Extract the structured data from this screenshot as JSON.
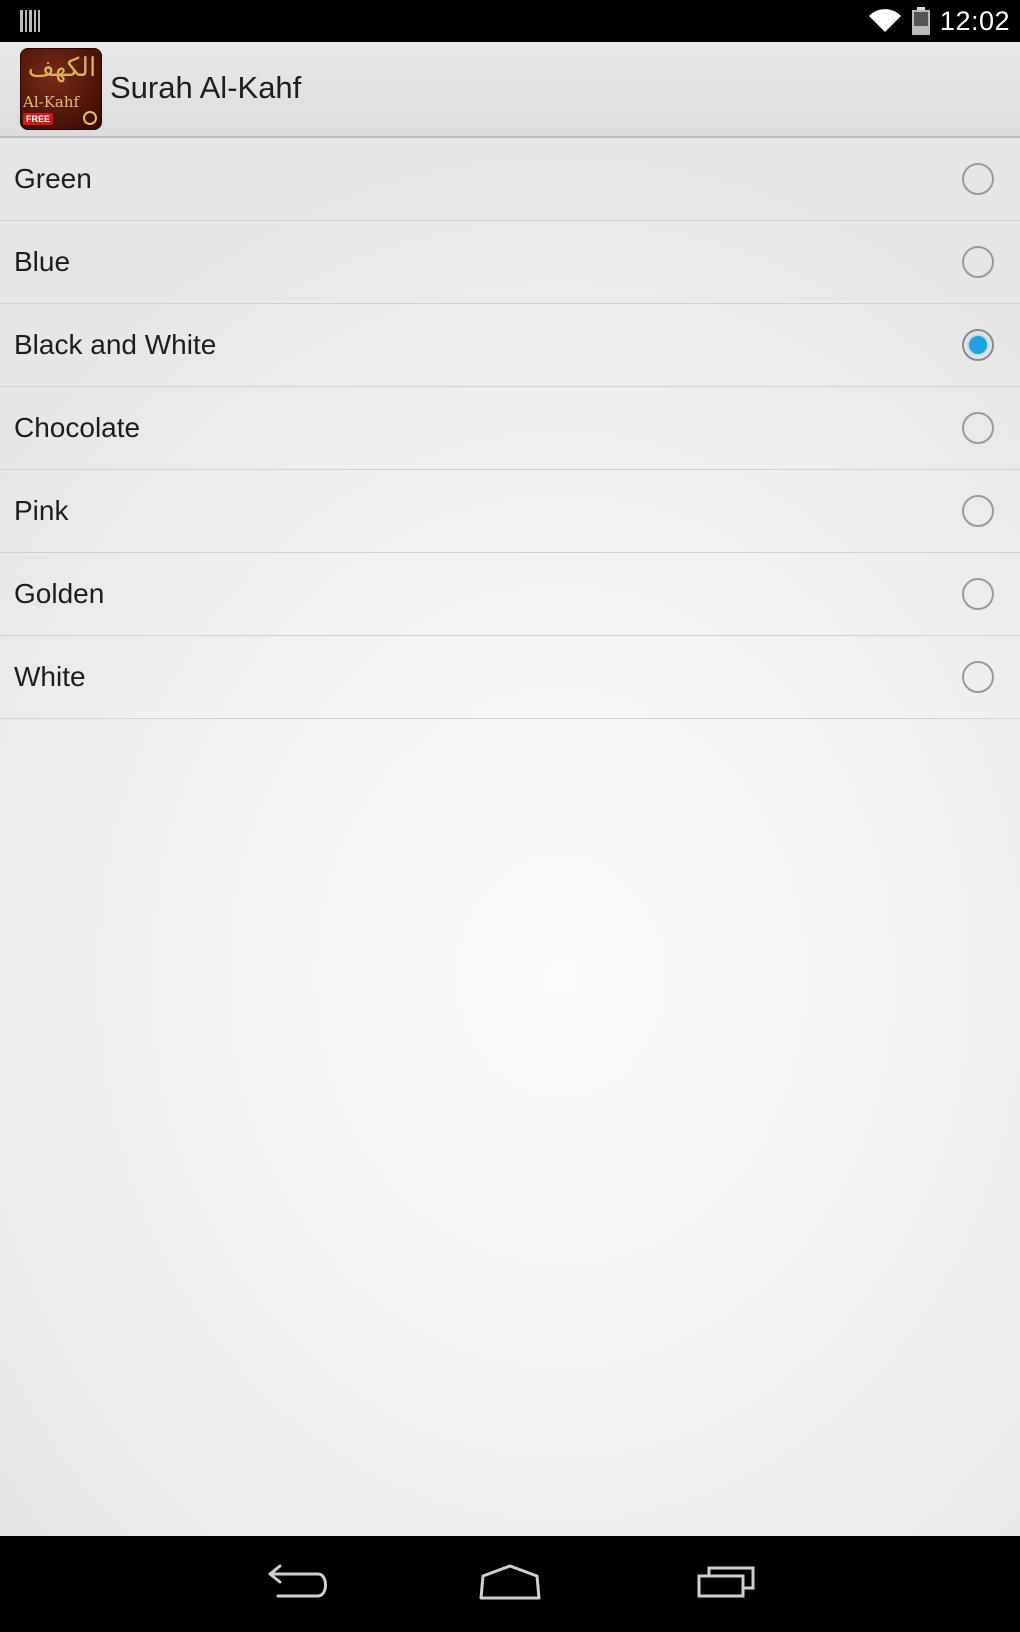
{
  "status_bar": {
    "time": "12:02",
    "left_icon": "barcode-notification-icon",
    "wifi_icon": "wifi-icon",
    "battery_icon": "battery-icon"
  },
  "action_bar": {
    "title": "Surah Al-Kahf",
    "app_icon": {
      "arabic_text": "الكهف",
      "label": "Al-Kahf",
      "badge": "FREE"
    }
  },
  "options": [
    {
      "label": "Green",
      "selected": false
    },
    {
      "label": "Blue",
      "selected": false
    },
    {
      "label": "Black and White",
      "selected": true
    },
    {
      "label": "Chocolate",
      "selected": false
    },
    {
      "label": "Pink",
      "selected": false
    },
    {
      "label": "Golden",
      "selected": false
    },
    {
      "label": "White",
      "selected": false
    }
  ],
  "colors": {
    "radio_selected": "#1ea3e0",
    "action_bar": "#e2e2e2"
  },
  "nav_bar": {
    "back_icon": "back-icon",
    "home_icon": "home-icon",
    "recent_icon": "recent-apps-icon"
  }
}
